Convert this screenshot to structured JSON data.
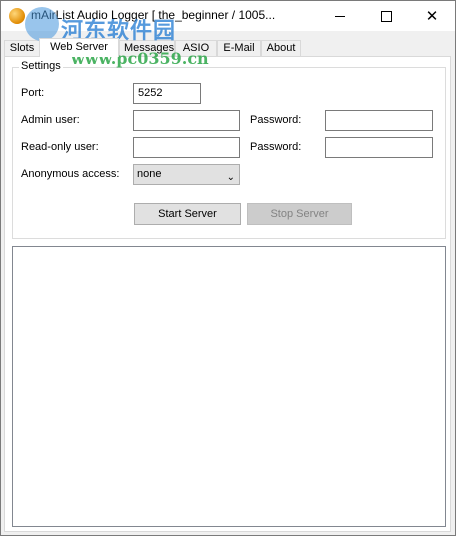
{
  "window": {
    "title": "mAirList Audio Logger [ the_beginner / 1005..."
  },
  "watermark": {
    "site_name_cn": "河东软件园",
    "site_url": "www.pc0359.cn"
  },
  "tabs": [
    {
      "label": "Slots",
      "active": false
    },
    {
      "label": "Web Server",
      "active": true
    },
    {
      "label": "Messages",
      "active": false
    },
    {
      "label": "ASIO",
      "active": false
    },
    {
      "label": "E-Mail",
      "active": false
    },
    {
      "label": "About",
      "active": false
    }
  ],
  "settings": {
    "group_title": "Settings",
    "port_label": "Port:",
    "port_value": "5252",
    "admin_user_label": "Admin user:",
    "admin_user_value": "",
    "admin_password_label": "Password:",
    "admin_password_value": "",
    "readonly_user_label": "Read-only user:",
    "readonly_user_value": "",
    "readonly_password_label": "Password:",
    "readonly_password_value": "",
    "anonymous_label": "Anonymous access:",
    "anonymous_value": "none"
  },
  "buttons": {
    "start": "Start Server",
    "stop": "Stop Server"
  }
}
